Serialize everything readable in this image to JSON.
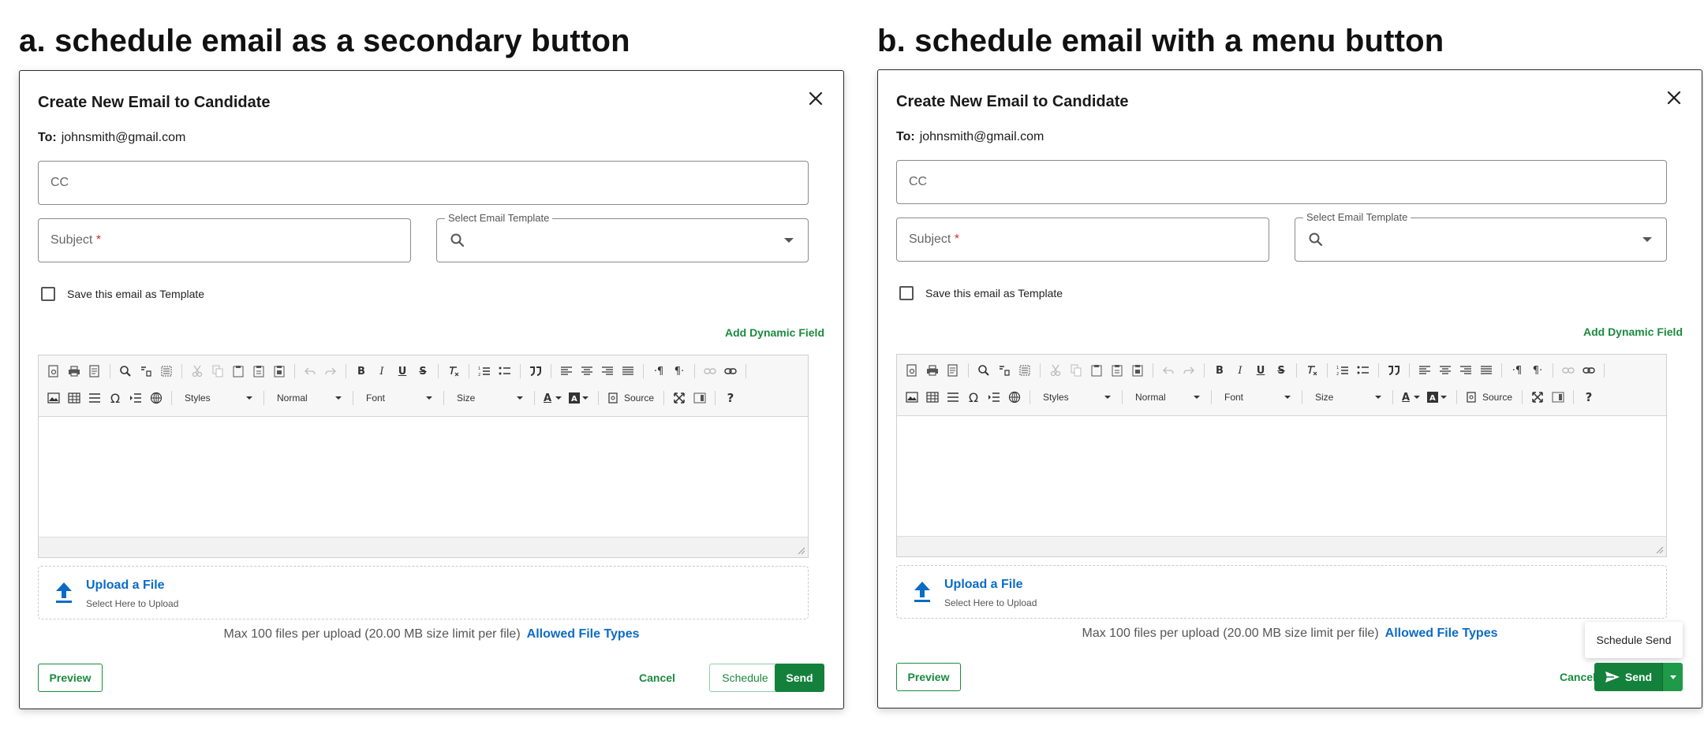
{
  "panels": [
    {
      "heading": "a. schedule email as a secondary button",
      "dialog_title": "Create New Email to Candidate",
      "to_label": "To:",
      "to_value": "johnsmith@gmail.com",
      "cc_placeholder": "CC",
      "subject_placeholder": "Subject",
      "required_marker": "*",
      "template_label": "Select Email Template",
      "save_template_label": "Save this email as Template",
      "add_dynamic_field": "Add Dynamic Field",
      "toolbar": {
        "styles": "Styles",
        "format": "Normal",
        "font": "Font",
        "size": "Size",
        "source": "Source",
        "help": "?",
        "omega": "Ω"
      },
      "upload_title": "Upload a File",
      "upload_subtitle": "Select Here to Upload",
      "limits_text": "Max 100 files per upload (20.00 MB size limit per file)",
      "allowed_types": "Allowed File Types",
      "buttons": {
        "preview": "Preview",
        "cancel": "Cancel",
        "schedule": "Schedule",
        "send": "Send"
      }
    },
    {
      "heading": "b. schedule email with a menu button",
      "dialog_title": "Create New Email to Candidate",
      "to_label": "To:",
      "to_value": "johnsmith@gmail.com",
      "cc_placeholder": "CC",
      "subject_placeholder": "Subject",
      "required_marker": "*",
      "template_label": "Select Email Template",
      "save_template_label": "Save this email as Template",
      "add_dynamic_field": "Add Dynamic Field",
      "toolbar": {
        "styles": "Styles",
        "format": "Normal",
        "font": "Font",
        "size": "Size",
        "source": "Source",
        "help": "?",
        "omega": "Ω"
      },
      "upload_title": "Upload a File",
      "upload_subtitle": "Select Here to Upload",
      "limits_text": "Max 100 files per upload (20.00 MB size limit per file)",
      "allowed_types": "Allowed File Types",
      "buttons": {
        "preview": "Preview",
        "cancel": "Cancel",
        "send": "Send"
      },
      "menu_item": "Schedule Send"
    }
  ],
  "colors": {
    "primary_green": "#13813b",
    "link_green": "#1b8a3f",
    "link_blue": "#0b6bc6",
    "required_red": "#d32f2f"
  }
}
